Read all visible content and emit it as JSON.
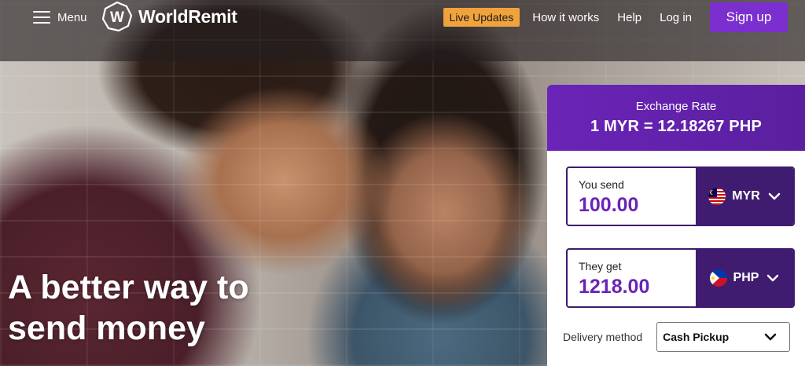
{
  "nav": {
    "menu_label": "Menu",
    "brand": "WorldRemit",
    "logo_letter": "W",
    "live_updates": "Live Updates",
    "links": [
      "How it works",
      "Help",
      "Log in"
    ],
    "signup": "Sign up"
  },
  "hero": {
    "headline_line1": "A better way to",
    "headline_line2": "send money"
  },
  "calculator": {
    "rate_title": "Exchange Rate",
    "rate_value": "1 MYR = 12.18267 PHP",
    "send_label": "You send",
    "send_amount": "100.00",
    "send_currency": "MYR",
    "get_label": "They get",
    "get_amount": "1218.00",
    "get_currency": "PHP",
    "delivery_label": "Delivery method",
    "delivery_value": "Cash Pickup"
  },
  "colors": {
    "brand_purple": "#7b2fcf",
    "dark_purple": "#3f1c6f",
    "live_updates_orange": "#f0a23c"
  },
  "icons": [
    "menu-icon",
    "worldremit-logo-icon",
    "malaysia-flag-icon",
    "philippines-flag-icon",
    "chevron-down-icon"
  ]
}
